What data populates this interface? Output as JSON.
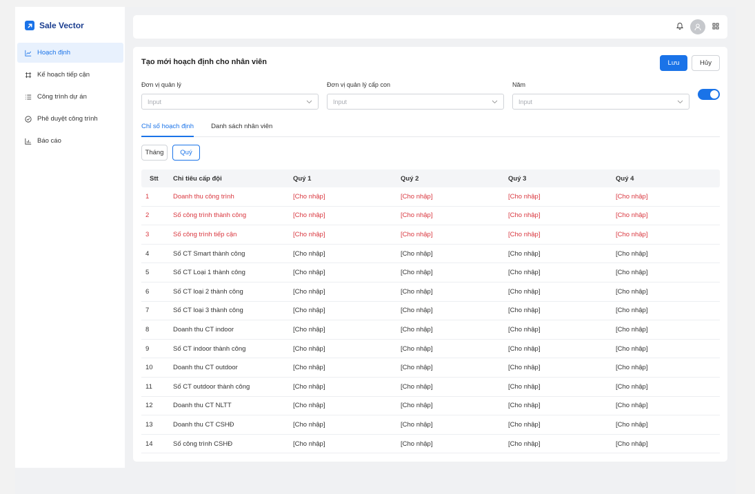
{
  "brand": {
    "name": "Sale Vector"
  },
  "sidebar": {
    "items": [
      {
        "label": "Hoạch định",
        "active": true,
        "icon": "line-chart-icon"
      },
      {
        "label": "Kế hoạch tiếp cận",
        "active": false,
        "icon": "frame-icon"
      },
      {
        "label": "Công trình dự án",
        "active": false,
        "icon": "list-icon"
      },
      {
        "label": "Phê duyệt công trình",
        "active": false,
        "icon": "check-circle-icon"
      },
      {
        "label": "Báo cáo",
        "active": false,
        "icon": "bar-chart-icon"
      }
    ]
  },
  "topbar": {
    "icons": [
      "bell-icon",
      "avatar-icon",
      "grid-icon"
    ]
  },
  "form": {
    "title": "Tạo mới hoạch định cho nhân viên",
    "save_label": "Lưu",
    "cancel_label": "Hủy",
    "fields": [
      {
        "label": "Đơn vị quản lý",
        "placeholder": "Input"
      },
      {
        "label": "Đơn vị quản lý cấp con",
        "placeholder": "Input"
      },
      {
        "label": "Năm",
        "placeholder": "Input"
      }
    ],
    "toggle_on": true
  },
  "tabs": [
    {
      "label": "Chỉ số hoạch định",
      "active": true
    },
    {
      "label": "Danh sách nhân viên",
      "active": false
    }
  ],
  "period": {
    "month": "Tháng",
    "quarter": "Quý",
    "selected": "quarter"
  },
  "table": {
    "headers": [
      "Stt",
      "Chỉ tiêu cấp đội",
      "Quý 1",
      "Quý 2",
      "Quý 3",
      "Quý 4"
    ],
    "rows": [
      {
        "stt": "1",
        "name": "Doanh thu công trình",
        "q1": "[Cho nhập]",
        "q2": "[Cho nhập]",
        "q3": "[Cho nhập]",
        "q4": "[Cho nhập]",
        "highlight": true
      },
      {
        "stt": "2",
        "name": "Số công trình thành công",
        "q1": "[Cho nhập]",
        "q2": "[Cho nhập]",
        "q3": "[Cho nhập]",
        "q4": "[Cho nhập]",
        "highlight": true
      },
      {
        "stt": "3",
        "name": "Số công trình tiếp cận",
        "q1": "[Cho nhập]",
        "q2": "[Cho nhập]",
        "q3": "[Cho nhập]",
        "q4": "[Cho nhập]",
        "highlight": true
      },
      {
        "stt": "4",
        "name": "Số CT Smart thành công",
        "q1": "[Cho nhập]",
        "q2": "[Cho nhập]",
        "q3": "[Cho nhập]",
        "q4": "[Cho nhập]",
        "highlight": false
      },
      {
        "stt": "5",
        "name": "Số CT Loại 1 thành công",
        "q1": "[Cho nhập]",
        "q2": "[Cho nhập]",
        "q3": "[Cho nhập]",
        "q4": "[Cho nhập]",
        "highlight": false
      },
      {
        "stt": "6",
        "name": "Số CT loại 2 thành công",
        "q1": "[Cho nhập]",
        "q2": "[Cho nhập]",
        "q3": "[Cho nhập]",
        "q4": "[Cho nhập]",
        "highlight": false
      },
      {
        "stt": "7",
        "name": "Số CT loại 3 thành công",
        "q1": "[Cho nhập]",
        "q2": "[Cho nhập]",
        "q3": "[Cho nhập]",
        "q4": "[Cho nhập]",
        "highlight": false
      },
      {
        "stt": "8",
        "name": "Doanh thu CT indoor",
        "q1": "[Cho nhập]",
        "q2": "[Cho nhập]",
        "q3": "[Cho nhập]",
        "q4": "[Cho nhập]",
        "highlight": false
      },
      {
        "stt": "9",
        "name": "Số CT indoor thành công",
        "q1": "[Cho nhập]",
        "q2": "[Cho nhập]",
        "q3": "[Cho nhập]",
        "q4": "[Cho nhập]",
        "highlight": false
      },
      {
        "stt": "10",
        "name": "Doanh thu CT outdoor",
        "q1": "[Cho nhập]",
        "q2": "[Cho nhập]",
        "q3": "[Cho nhập]",
        "q4": "[Cho nhập]",
        "highlight": false
      },
      {
        "stt": "11",
        "name": "Số CT outdoor thành công",
        "q1": "[Cho nhập]",
        "q2": "[Cho nhập]",
        "q3": "[Cho nhập]",
        "q4": "[Cho nhập]",
        "highlight": false
      },
      {
        "stt": "12",
        "name": "Doanh thu CT NLTT",
        "q1": "[Cho nhập]",
        "q2": "[Cho nhập]",
        "q3": "[Cho nhập]",
        "q4": "[Cho nhập]",
        "highlight": false
      },
      {
        "stt": "13",
        "name": "Doanh thu CT CSHĐ",
        "q1": "[Cho nhập]",
        "q2": "[Cho nhập]",
        "q3": "[Cho nhập]",
        "q4": "[Cho nhập]",
        "highlight": false
      },
      {
        "stt": "14",
        "name": "Số công  trình CSHĐ",
        "q1": "[Cho nhập]",
        "q2": "[Cho nhập]",
        "q3": "[Cho nhập]",
        "q4": "[Cho nhập]",
        "highlight": false
      }
    ]
  },
  "colors": {
    "accent": "#1a73e8",
    "danger": "#d9363e",
    "brand_text": "#1a3d8f"
  }
}
